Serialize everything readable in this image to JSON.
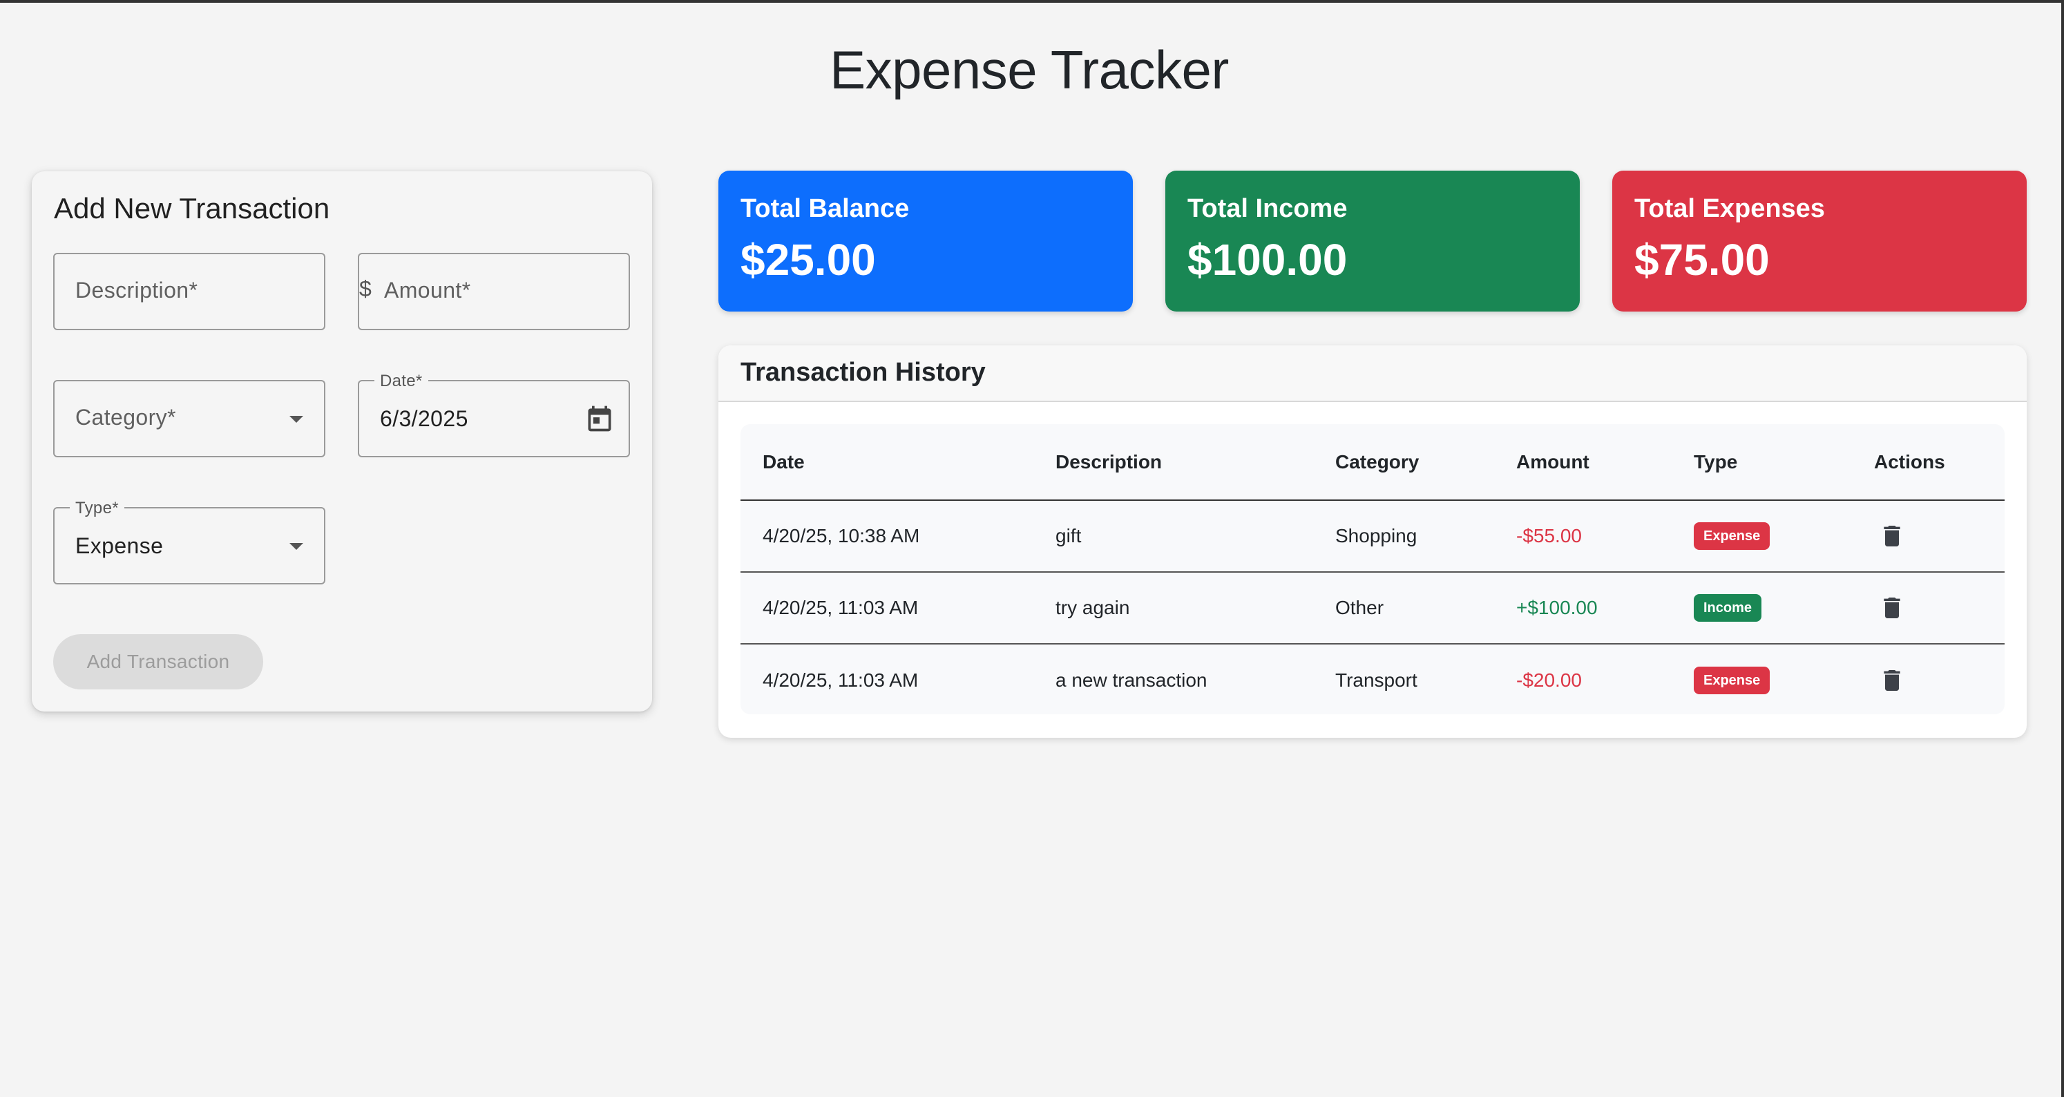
{
  "app": {
    "title": "Expense Tracker"
  },
  "form": {
    "title": "Add New Transaction",
    "description_placeholder": "Description*",
    "amount_prefix": "$",
    "amount_placeholder": "Amount*",
    "category_placeholder": "Category*",
    "date_label": "Date*",
    "date_value": "6/3/2025",
    "type_label": "Type*",
    "type_value": "Expense",
    "submit_label": "Add Transaction"
  },
  "summary": {
    "balance_label": "Total Balance",
    "balance_value": "$25.00",
    "income_label": "Total Income",
    "income_value": "$100.00",
    "expenses_label": "Total Expenses",
    "expenses_value": "$75.00"
  },
  "history": {
    "title": "Transaction History",
    "columns": [
      "Date",
      "Description",
      "Category",
      "Amount",
      "Type",
      "Actions"
    ],
    "rows": [
      {
        "date": "4/20/25, 10:38 AM",
        "description": "gift",
        "category": "Shopping",
        "amount": "-$55.00",
        "type": "Expense"
      },
      {
        "date": "4/20/25, 11:03 AM",
        "description": "try again",
        "category": "Other",
        "amount": "+$100.00",
        "type": "Income"
      },
      {
        "date": "4/20/25, 11:03 AM",
        "description": "a new transaction",
        "category": "Transport",
        "amount": "-$20.00",
        "type": "Expense"
      }
    ]
  },
  "icons": {
    "category_dropdown": "chevron-down-icon",
    "type_dropdown": "chevron-down-icon",
    "date_picker": "calendar-icon",
    "row_action": "trash-icon"
  },
  "colors": {
    "balance": "#0d6efd",
    "income": "#198754",
    "expense": "#dc3545"
  }
}
